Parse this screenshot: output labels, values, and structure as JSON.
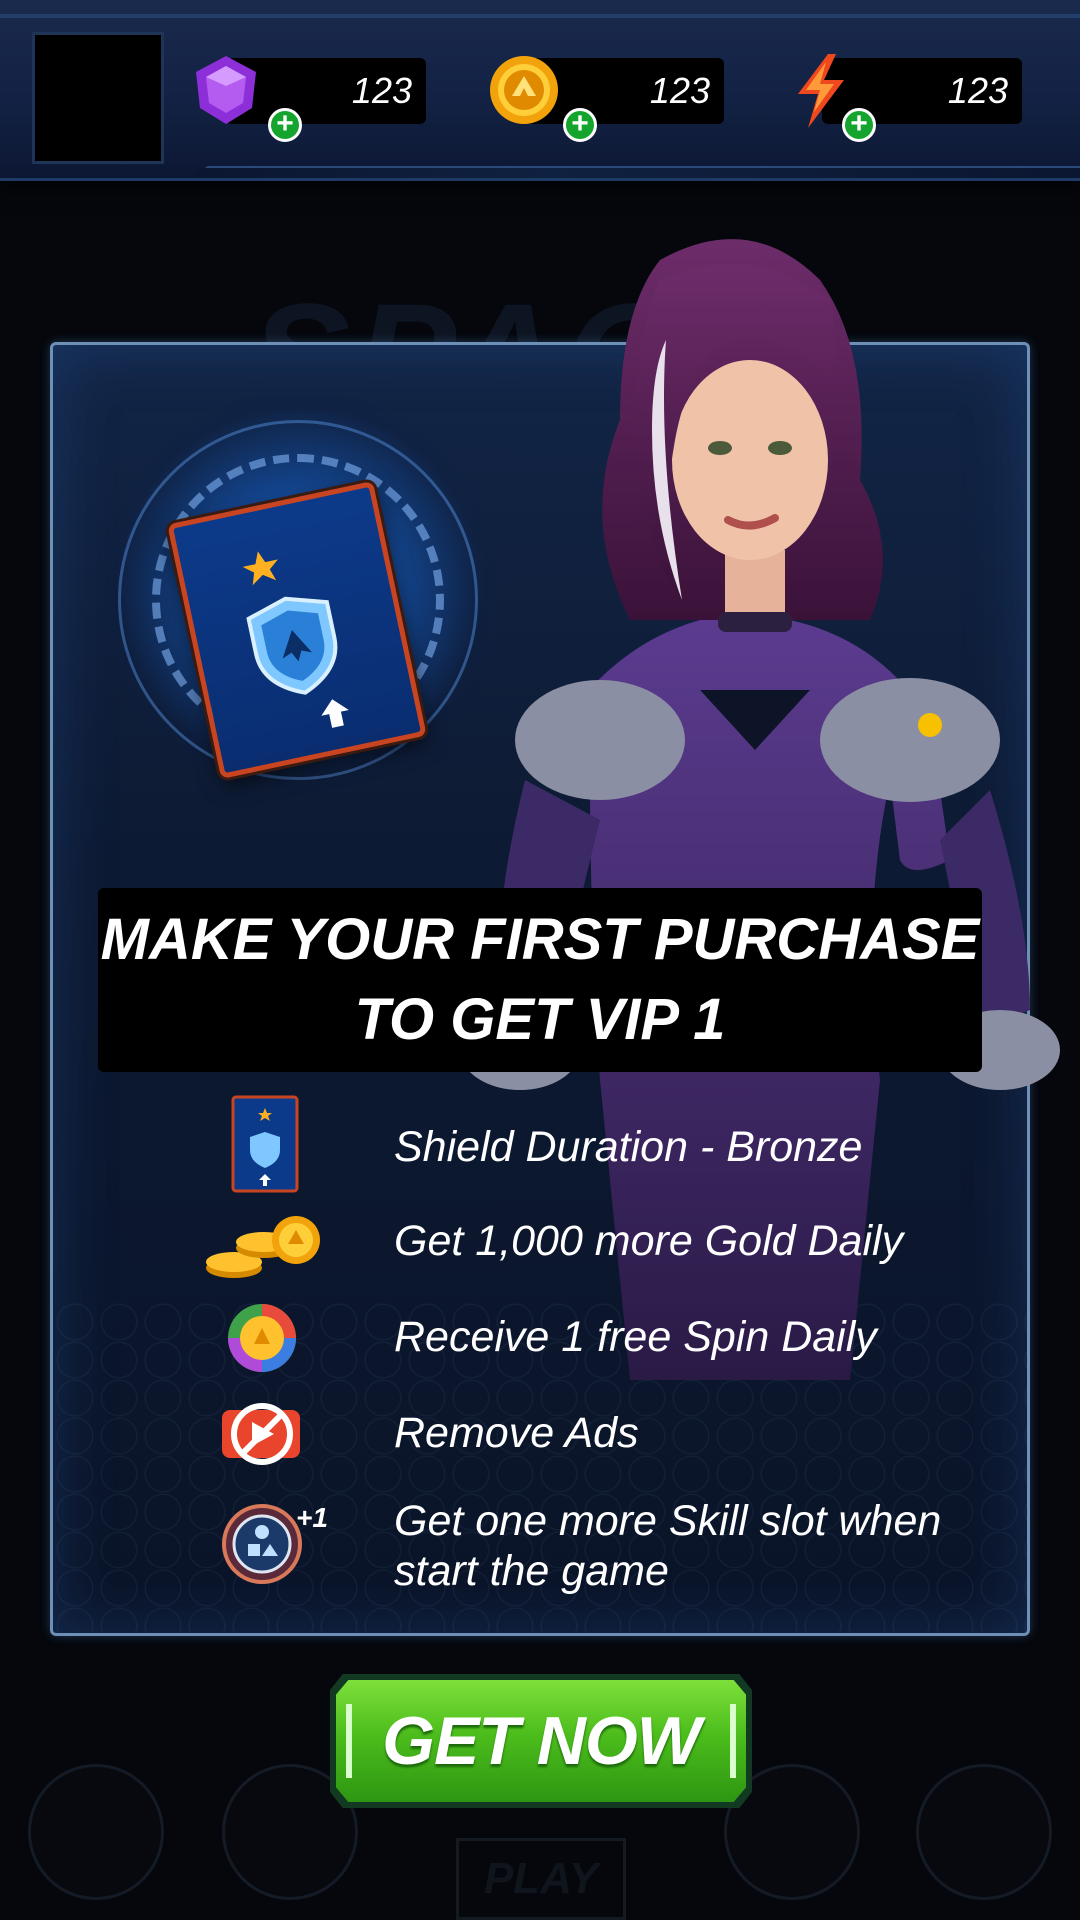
{
  "header": {
    "resources": [
      {
        "name": "gems",
        "icon": "gem-icon",
        "value": "123"
      },
      {
        "name": "gold",
        "icon": "gold-coin-icon",
        "value": "123"
      },
      {
        "name": "energy",
        "icon": "lightning-icon",
        "value": "123"
      }
    ]
  },
  "background": {
    "bottom_nav_play": "PLAY"
  },
  "offer": {
    "headline_line1": "MAKE YOUR FIRST PURCHASE",
    "headline_line2": "TO GET VIP 1",
    "benefits": [
      {
        "icon": "shield-card-icon",
        "text": "Shield Duration - Bronze"
      },
      {
        "icon": "gold-coins-stack-icon",
        "text": "Get 1,000 more Gold Daily"
      },
      {
        "icon": "spin-wheel-icon",
        "text": "Receive 1 free Spin Daily"
      },
      {
        "icon": "no-ads-icon",
        "text": "Remove Ads"
      },
      {
        "icon": "skill-slot-icon",
        "badge": "+1",
        "text_line1": "Get one more Skill slot when",
        "text_line2": "start the game"
      }
    ],
    "cta_label": "GET NOW"
  },
  "colors": {
    "cta_green": "#4cbd1c",
    "plus_green": "#15a52f",
    "panel_border": "#6e8fb6",
    "card_border": "#c94522"
  }
}
